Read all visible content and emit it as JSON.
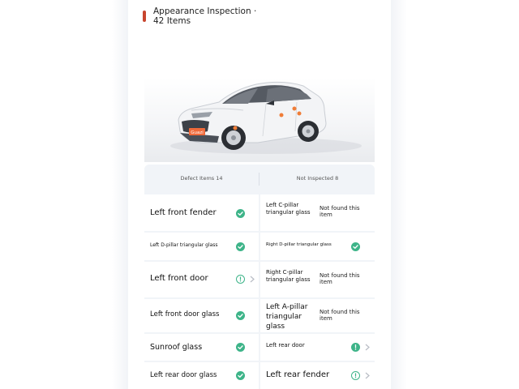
{
  "header": {
    "title": "Appearance Inspection · 42 Items",
    "marker_color": "#c8452e"
  },
  "car_image": {
    "alt": "3D car model with defect markers",
    "badge_text": "Guazi",
    "marker_color": "#ef7d38"
  },
  "tabs": [
    {
      "label": "Defect Items 14"
    },
    {
      "label": "Not Inspected 8"
    }
  ],
  "defect_items": [
    {
      "name": "Left front fender",
      "status": "ok"
    },
    {
      "name": "Left D-pillar triangular glass",
      "status": "ok"
    },
    {
      "name": "Left front door",
      "status": "warning"
    },
    {
      "name": "Left front door glass",
      "status": "ok"
    },
    {
      "name": "Sunroof glass",
      "status": "ok"
    },
    {
      "name": "Left rear door glass",
      "status": "ok"
    }
  ],
  "not_inspected_items": [
    {
      "name": "Left C-pillar triangular glass",
      "note": "Not found this item"
    },
    {
      "name": "Right D-pillar triangular glass",
      "status": "ok"
    },
    {
      "name": "Right C-pillar triangular glass",
      "note": "Not found this item"
    },
    {
      "name": "Left A-pillar triangular glass",
      "note": "Not found this item"
    },
    {
      "name": "Left rear door",
      "status": "warning"
    },
    {
      "name": "Left rear fender",
      "status": "warning"
    }
  ],
  "colors": {
    "ok": "#3eb489",
    "warning": "#3eb489",
    "chevron": "#b8bcc4",
    "table_bg": "#f1f4f8"
  }
}
